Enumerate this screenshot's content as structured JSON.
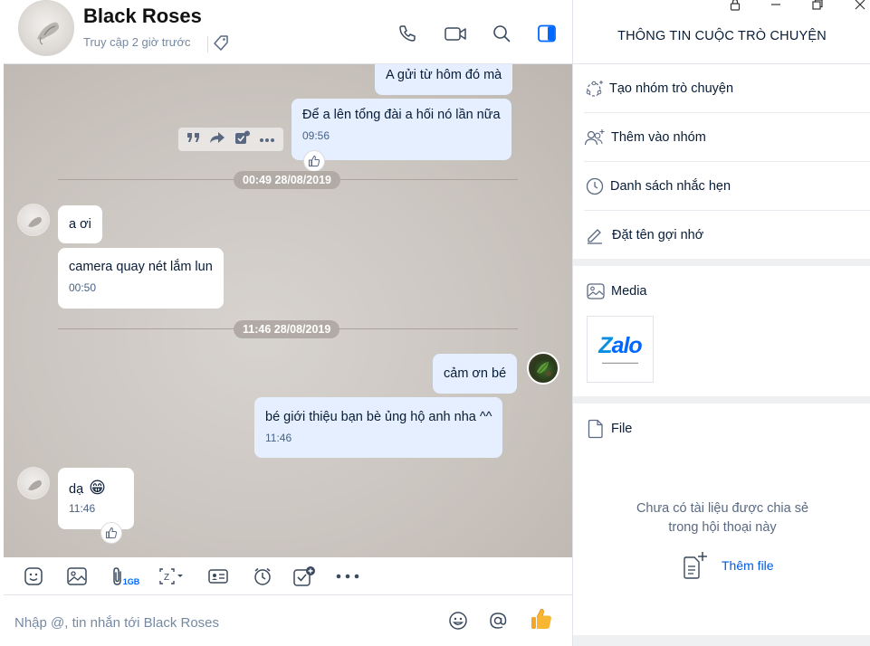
{
  "header": {
    "contact_name": "Black Roses",
    "last_seen": "Truy cập 2 giờ trước"
  },
  "messages": [
    {
      "side": "me",
      "text": "A gửi từ hôm đó mà"
    },
    {
      "side": "me",
      "text": "Để a lên tổng đài a hối nó lần nữa",
      "time": "09:56"
    },
    {
      "side": "divider",
      "text": "00:49 28/08/2019"
    },
    {
      "side": "them",
      "text": "a ơi"
    },
    {
      "side": "them",
      "text": "camera quay nét lắm lun",
      "time": "00:50"
    },
    {
      "side": "divider",
      "text": "11:46 28/08/2019"
    },
    {
      "side": "me",
      "text": "cảm ơn bé"
    },
    {
      "side": "me",
      "text": "bé giới thiệu bạn bè ủng hộ anh nha ^^",
      "time": "11:46"
    },
    {
      "side": "them",
      "text": "dạ",
      "emoji": "😁",
      "time": "11:46"
    }
  ],
  "toolbar": {
    "attach_size_badge": "1GB"
  },
  "input": {
    "placeholder": "Nhập @, tin nhắn tới Black Roses"
  },
  "panel": {
    "title": "THÔNG TIN CUỘC TRÒ CHUYỆN",
    "menu": [
      {
        "icon": "create-group-icon",
        "label": "Tạo nhóm trò chuyện"
      },
      {
        "icon": "add-to-group-icon",
        "label": "Thêm vào nhóm"
      },
      {
        "icon": "reminder-clock-icon",
        "label": "Danh sách nhắc hẹn"
      },
      {
        "icon": "pencil-icon",
        "label": "Đặt tên gợi nhớ"
      }
    ],
    "media_title": "Media",
    "media_thumb_logo": "Zalo",
    "file_title": "File",
    "empty_files_line1": "Chưa có tài liệu được chia sẻ",
    "empty_files_line2": "trong hội thoại này",
    "add_file_label": "Thêm file"
  },
  "colors": {
    "accent": "#0068ff",
    "bubble_me": "#e5efff",
    "bubble_them": "#ffffff",
    "chat_bg": "#cbc5c0"
  }
}
